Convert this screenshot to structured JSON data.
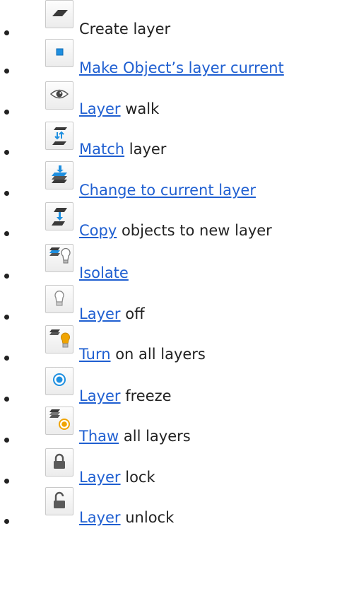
{
  "items": [
    {
      "icon": "create-layer-icon",
      "link": "",
      "text": "Create layer"
    },
    {
      "icon": "make-current-icon",
      "link": "Make Object’s layer current",
      "text": ""
    },
    {
      "icon": "eye-icon",
      "link": "Layer",
      "text": " walk"
    },
    {
      "icon": "match-layer-icon",
      "link": "Match",
      "text": " layer"
    },
    {
      "icon": "change-layer-icon",
      "link": "Change to current layer",
      "text": ""
    },
    {
      "icon": "copy-layer-icon",
      "link": "Copy",
      "text": " objects to new layer"
    },
    {
      "icon": "isolate-icon",
      "link": "Isolate",
      "text": ""
    },
    {
      "icon": "bulb-off-icon",
      "link": "Layer",
      "text": " off"
    },
    {
      "icon": "bulb-on-icon",
      "link": "Turn",
      "text": " on all layers"
    },
    {
      "icon": "freeze-icon",
      "link": "Layer",
      "text": " freeze"
    },
    {
      "icon": "thaw-icon",
      "link": "Thaw",
      "text": " all layers"
    },
    {
      "icon": "lock-icon",
      "link": "Layer",
      "text": " lock"
    },
    {
      "icon": "unlock-icon",
      "link": "Layer",
      "text": " unlock"
    }
  ],
  "colors": {
    "link": "#1f5fd1",
    "text": "#222222",
    "accent_blue": "#1e8fe0",
    "accent_orange": "#f0a400"
  }
}
